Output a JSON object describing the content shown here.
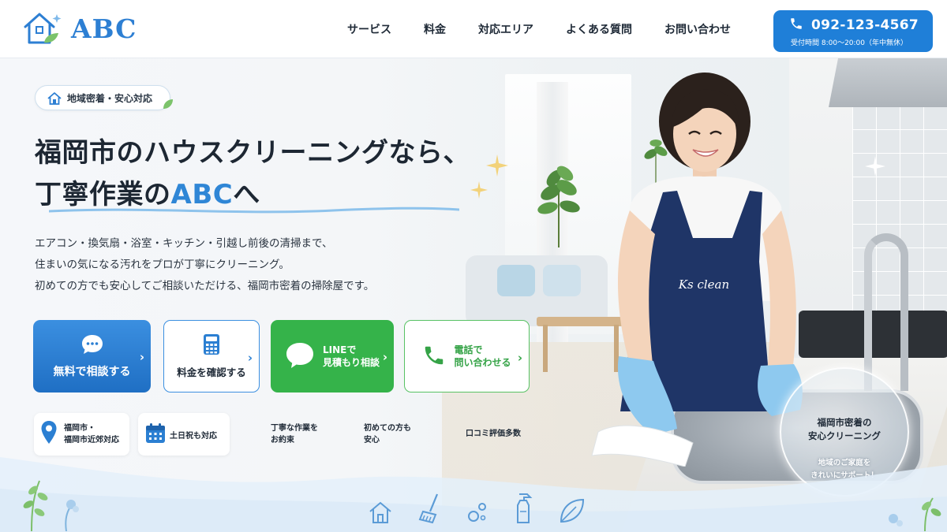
{
  "header": {
    "logo_text": "ABC",
    "nav": [
      "サービス",
      "料金",
      "対応エリア",
      "よくある質問",
      "お問い合わせ"
    ],
    "phone_number": "092-123-4567",
    "phone_hours": "受付時間 8:00〜20:00（年中無休）"
  },
  "hero": {
    "badge": "地域密着・安心対応",
    "headline_line1": "福岡市のハウスクリーニングなら、",
    "headline_line2_prefix": "丁寧作業の",
    "headline_line2_accent": "ABC",
    "headline_line2_suffix": "へ",
    "description": [
      "エアコン・換気扇・浴室・キッチン・引越し前後の清掃まで、",
      "住まいの気になる汚れをプロが丁寧にクリーニング。",
      "初めての方でも安心してご相談いただける、福岡市密着の掃除屋です。"
    ],
    "apron_text": "Ks clean"
  },
  "cta": {
    "consult": "無料で相談する",
    "price": "料金を確認する",
    "line_1": "LINEで",
    "line_2": "見積もり相談",
    "tel_1": "電話で",
    "tel_2": "問い合わせる"
  },
  "features": {
    "area_1": "福岡市・",
    "area_2": "福岡市近郊対応",
    "weekend": "土日祝も対応",
    "careful_1": "丁寧な作業を",
    "careful_2": "お約束",
    "first_1": "初めての方も",
    "first_2": "安心",
    "reviews": "口コミ評価多数"
  },
  "bubble": {
    "title_1": "福岡市密着の",
    "title_2": "安心クリーニング",
    "sub_1": "地域のご家庭を",
    "sub_2": "きれいにサポート！"
  },
  "colors": {
    "brand": "#2d7fd3",
    "line_green": "#35b34a",
    "text": "#1f2a37"
  },
  "icons": [
    "house-logo-icon",
    "phone-icon",
    "chat-icon",
    "calculator-icon",
    "line-icon",
    "handset-icon",
    "map-pin-icon",
    "calendar-icon",
    "house-icon",
    "broom-icon",
    "bubbles-icon",
    "spray-bottle-icon",
    "leaf-icon"
  ]
}
